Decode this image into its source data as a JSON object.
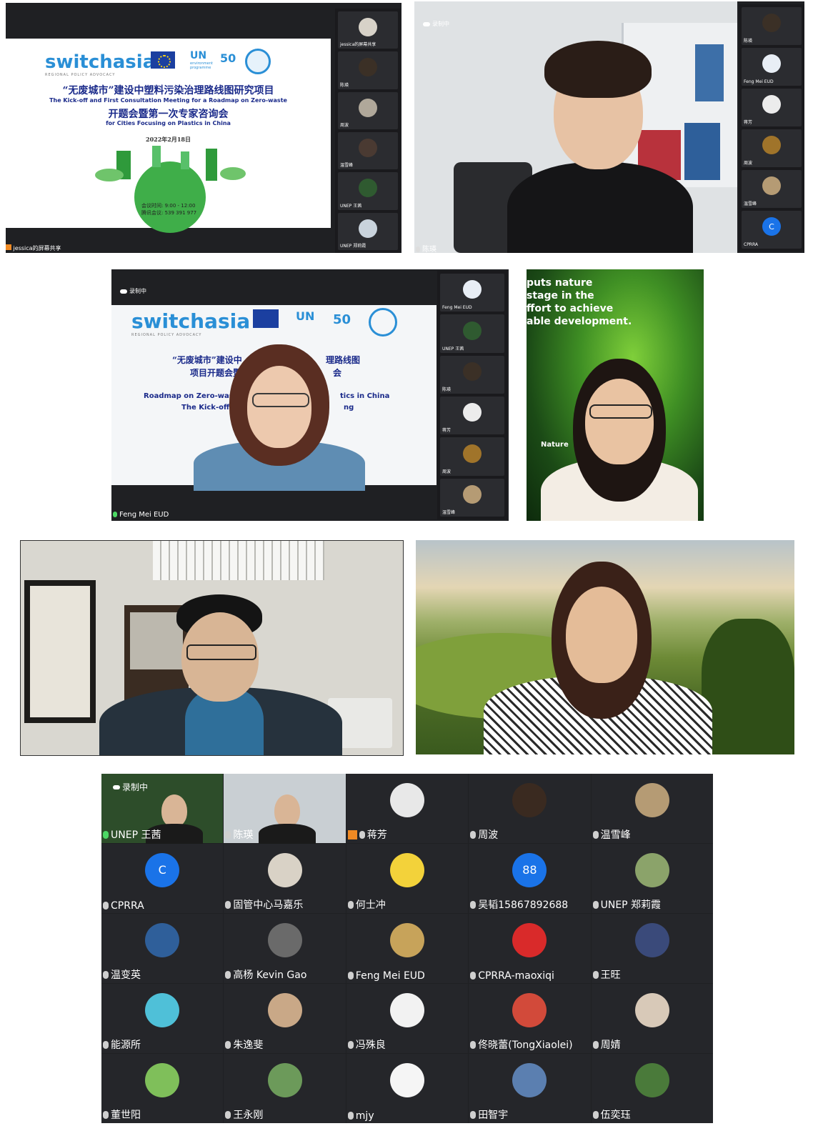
{
  "panel1": {
    "slide": {
      "brand": "switchasia",
      "brand_sub": "REGIONAL POLICY ADVOCACY",
      "un_logo": "UN",
      "un_sub": "environment programme",
      "fifty": "50",
      "title_cn_1": "“无废城市”建设中塑料污染治理路线图研究项目",
      "title_en_1": "The Kick-off and First Consultation Meeting for a Roadmap on Zero-waste",
      "title_cn_2": "开题会暨第一次专家咨询会",
      "title_en_2": "for Cities Focusing on Plastics in China",
      "date": "2022年2月18日",
      "time": "会议时间: 9:00 - 12:00",
      "meeting_id": "腾讯会议: 539 391 977"
    },
    "presenter": "jessica的屏幕共享",
    "thumbs": [
      "jessica的屏幕共享",
      "陈瑛",
      "周波",
      "温雪峰",
      "UNEP 王茜",
      "UNEP 郑莉霞"
    ]
  },
  "panel2": {
    "recording": "录制中",
    "speaker": "陈瑛",
    "thumbs": [
      "陈瑛",
      "Feng Mei EUD",
      "蒋芳",
      "周波",
      "温雪峰",
      "CPRRA"
    ],
    "cprra_letter": "C"
  },
  "panel3": {
    "recording": "录制中",
    "slide": {
      "brand": "switchasia",
      "brand_sub": "REGIONAL POLICY ADVOCACY",
      "un_logo": "UN",
      "fifty": "50",
      "title_cn_1": "“无废城市”建设中",
      "title_cn_1b": "理路线图",
      "title_cn_2": "项目开题会暨",
      "title_cn_2b": "会",
      "title_en_1": "Roadmap on Zero-waste fo",
      "title_en_1b": "tics in China",
      "title_en_2": "The Kick-off and",
      "title_en_2b": "ng"
    },
    "speaker": "Feng Mei EUD",
    "thumbs": [
      "Feng Mei EUD",
      "UNEP 王茜",
      "陈瑛",
      "蒋芳",
      "周波",
      "温雪峰"
    ]
  },
  "panel4": {
    "bg_text_1": "puts nature",
    "bg_text_2": "stage in the",
    "bg_text_3": "ffort to achieve",
    "bg_text_4": "able development.",
    "bg_text_5": "Nature"
  },
  "grid": {
    "recording": "录制中",
    "participants": [
      {
        "name": "UNEP 王茜",
        "kind": "video",
        "color": "#2d4d2a"
      },
      {
        "name": "陈瑛",
        "kind": "video",
        "color": "#c9cfd3"
      },
      {
        "name": "蒋芳",
        "kind": "avatar",
        "color": "#e8e8e8",
        "host": true
      },
      {
        "name": "周波",
        "kind": "avatar",
        "color": "#3a2a20"
      },
      {
        "name": "温雪峰",
        "kind": "avatar",
        "color": "#b59b74"
      },
      {
        "name": "CPRRA",
        "kind": "letter",
        "color": "#1a73e8",
        "letter": "C"
      },
      {
        "name": "固管中心马嘉乐",
        "kind": "avatar",
        "color": "#d9d2c6"
      },
      {
        "name": "何士冲",
        "kind": "avatar",
        "color": "#f3d23a"
      },
      {
        "name": "吴韬15867892688",
        "kind": "letter",
        "color": "#1a73e8",
        "letter": "88"
      },
      {
        "name": "UNEP 郑莉霞",
        "kind": "avatar",
        "color": "#8ba36a"
      },
      {
        "name": "温变英",
        "kind": "avatar",
        "color": "#2f5f9a"
      },
      {
        "name": "高杨 Kevin Gao",
        "kind": "avatar",
        "color": "#6a6a6a"
      },
      {
        "name": "Feng Mei EUD",
        "kind": "avatar",
        "color": "#c7a35a"
      },
      {
        "name": "CPRRA-maoxiqi",
        "kind": "avatar",
        "color": "#d92a2a"
      },
      {
        "name": "王旺",
        "kind": "avatar",
        "color": "#3a4a7a"
      },
      {
        "name": "能源所",
        "kind": "avatar",
        "color": "#4fc0d8"
      },
      {
        "name": "朱逸斐",
        "kind": "avatar",
        "color": "#c9a887"
      },
      {
        "name": "冯殊良",
        "kind": "avatar",
        "color": "#f2f2f2"
      },
      {
        "name": "佟晓蕾(TongXiaolei)",
        "kind": "avatar",
        "color": "#d24a3a"
      },
      {
        "name": "周婧",
        "kind": "avatar",
        "color": "#d8c9b8"
      },
      {
        "name": "董世阳",
        "kind": "avatar",
        "color": "#7fbf5a"
      },
      {
        "name": "王永刚",
        "kind": "avatar",
        "color": "#6c9a5a"
      },
      {
        "name": "mjy",
        "kind": "avatar",
        "color": "#f5f5f5"
      },
      {
        "name": "田智宇",
        "kind": "avatar",
        "color": "#5b7fb0"
      },
      {
        "name": "伍奕珏",
        "kind": "avatar",
        "color": "#4a7a3a"
      }
    ]
  }
}
